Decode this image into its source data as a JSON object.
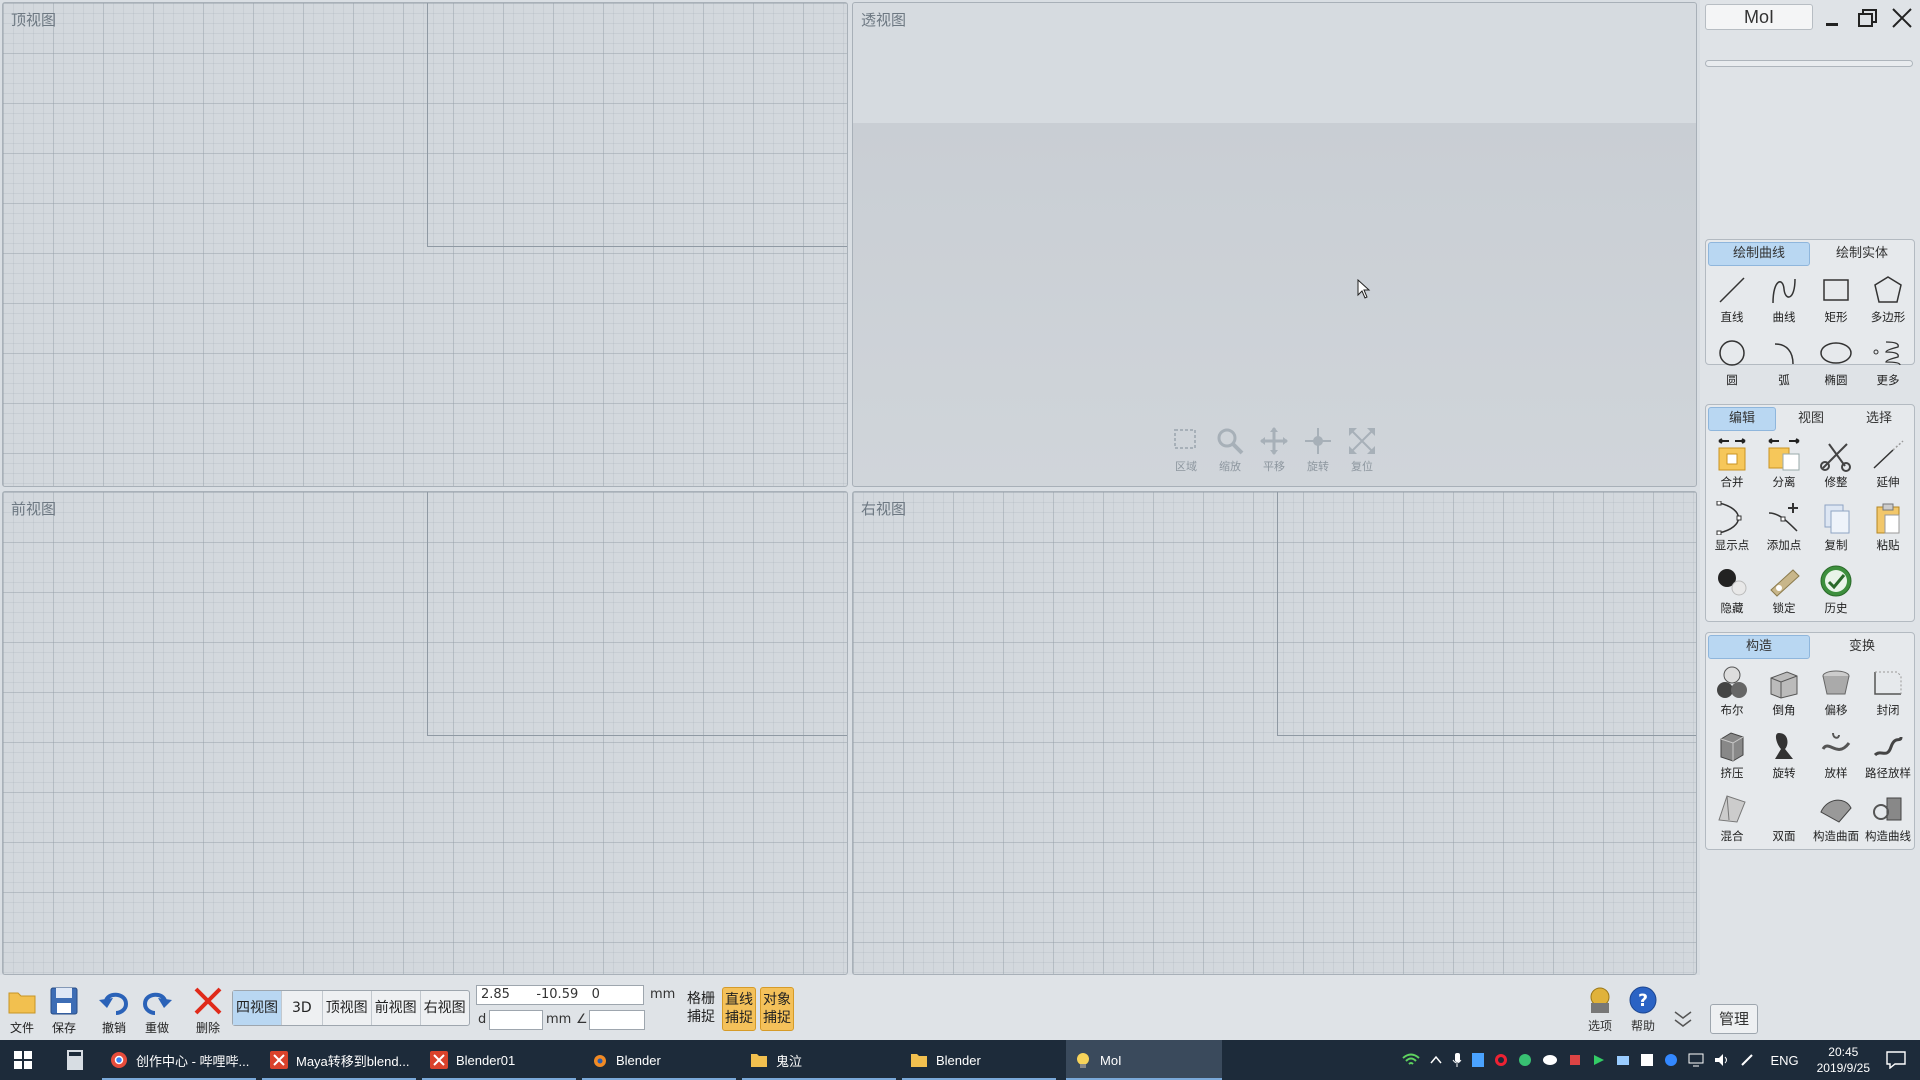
{
  "viewports": {
    "top": "顶视图",
    "perspective": "透视图",
    "front": "前视图",
    "right": "右视图"
  },
  "nav_tools": [
    "区域",
    "缩放",
    "平移",
    "旋转",
    "复位"
  ],
  "window": {
    "title": "MoI"
  },
  "panel_draw": {
    "tabs": [
      "绘制曲线",
      "绘制实体"
    ],
    "tools": [
      "直线",
      "曲线",
      "矩形",
      "多边形",
      "圆",
      "弧",
      "椭圆",
      "更多"
    ]
  },
  "panel_edit": {
    "tabs": [
      "编辑",
      "视图",
      "选择"
    ],
    "tools": [
      "合并",
      "分离",
      "修整",
      "延伸",
      "显示点",
      "添加点",
      "复制",
      "粘贴",
      "隐藏",
      "锁定",
      "历史"
    ]
  },
  "panel_construct": {
    "tabs": [
      "构造",
      "变换"
    ],
    "tools": [
      "布尔",
      "倒角",
      "偏移",
      "封闭",
      "挤压",
      "旋转",
      "放样",
      "路径放样",
      "混合",
      "双面",
      "构造曲面",
      "构造曲线"
    ]
  },
  "toolbar": {
    "file": "文件",
    "save": "保存",
    "undo": "撤销",
    "redo": "重做",
    "delete": "删除",
    "views": [
      "四视图",
      "3D",
      "顶视图",
      "前视图",
      "右视图"
    ],
    "coords": [
      "2.85",
      "-10.59",
      "0"
    ],
    "unit": "mm",
    "distance_label": "d",
    "distance_unit": "mm",
    "angle_label": "∠",
    "snap_grid": [
      "格栅",
      "捕捉"
    ],
    "snap_line": [
      "直线",
      "捕捉"
    ],
    "snap_object": [
      "对象",
      "捕捉"
    ],
    "options": "选项",
    "help": "帮助",
    "manage": "管理"
  },
  "taskbar": {
    "items": [
      "创作中心 - 哔哩哔...",
      "Maya转移到blend...",
      "Blender01",
      "Blender",
      "鬼泣",
      "Blender",
      "MoI"
    ],
    "lang": "ENG",
    "time": "20:45",
    "date": "2019/9/25"
  },
  "colors": {
    "accent_tab": "#b9d7f2",
    "snap_on": "#f4c15a",
    "taskbar": "#1d2b3a"
  }
}
